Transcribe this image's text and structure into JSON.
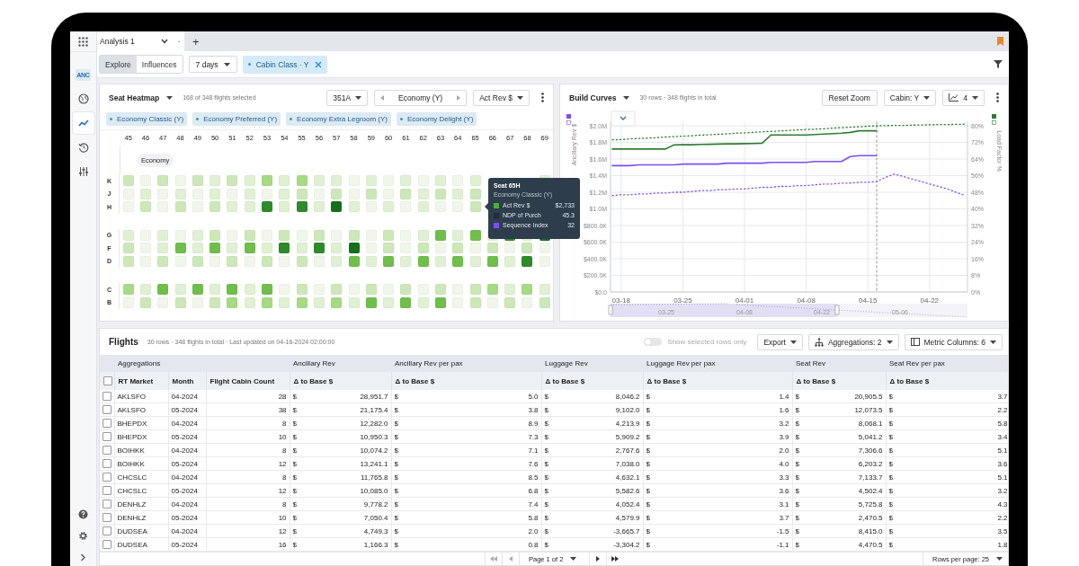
{
  "sidebar": {
    "items": [
      {
        "kind": "apps",
        "selected": false
      },
      {
        "kind": "logo",
        "label": "ANC",
        "selected": false
      },
      {
        "kind": "globe",
        "selected": false
      },
      {
        "kind": "trend",
        "selected": true
      },
      {
        "kind": "history",
        "selected": false
      },
      {
        "kind": "sliders",
        "selected": false
      }
    ],
    "bottom_items": [
      {
        "kind": "help"
      },
      {
        "kind": "settings"
      },
      {
        "kind": "expand"
      }
    ]
  },
  "tabs": [
    {
      "label": "Analysis 1",
      "selected": true
    }
  ],
  "tab_dot": "·",
  "new_tab": "+",
  "toolbar": {
    "view_modes": [
      {
        "label": "Explore",
        "selected": true
      },
      {
        "label": "Influences",
        "selected": false
      }
    ],
    "period": "7 days",
    "filters": [
      {
        "label": "Cabin Class · Y"
      }
    ]
  },
  "seat_heatmap": {
    "title": "Seat Heatmap",
    "subtitle": "168 of 348 flights selected",
    "aircraft": "351A",
    "cabin": "Economy (Y)",
    "metric": "Act Rev $",
    "fare_classes": [
      "Economy Classic (Y)",
      "Economy Preferred (Y)",
      "Economy Extra Legroom (Y)",
      "Economy Delight (Y)"
    ],
    "columns": [
      "45",
      "46",
      "47",
      "48",
      "49",
      "50",
      "51",
      "52",
      "53",
      "54",
      "55",
      "56",
      "57",
      "58",
      "59",
      "60",
      "61",
      "62",
      "63",
      "64",
      "65",
      "66",
      "67",
      "68",
      "69"
    ],
    "section_label": "Economy",
    "row_groups": [
      [
        "K",
        "J",
        "H"
      ],
      [
        "G",
        "F",
        "D"
      ],
      [
        "C",
        "B"
      ]
    ],
    "tooltip": {
      "title": "Seat 65H",
      "subtitle": "Economy Classic (Y)",
      "items": [
        {
          "label": "Act Rev $",
          "value": "$2,733",
          "color": "#4caf3a"
        },
        {
          "label": "NDP of Purch",
          "value": "45.3",
          "color": "#1e2d3a"
        },
        {
          "label": "Sequence Index",
          "value": "32",
          "color": "#7c4dff"
        }
      ]
    }
  },
  "build_curves": {
    "title": "Build Curves",
    "subtitle": "30 rows · 348 flights in total",
    "reset_button": "Reset Zoom",
    "cabin": "Cabin: Y",
    "series_count": "4",
    "navigator_labels": [
      "03-25",
      "04-08",
      "04-22",
      "05-06"
    ],
    "chart_data": {
      "type": "line",
      "ylabel": "Ancillary Rev $",
      "y2label": "Load Factor %",
      "grid": true,
      "categories": [
        null,
        "03-18",
        null,
        null,
        null,
        null,
        null,
        null,
        "03-25",
        null,
        null,
        null,
        null,
        null,
        null,
        "04-01",
        null,
        null,
        null,
        null,
        null,
        null,
        "04-08",
        null,
        null,
        null,
        null,
        null,
        null,
        "04-15",
        null,
        null,
        null,
        null,
        null,
        null,
        "04-22",
        null,
        null,
        null,
        null
      ],
      "series": [
        {
          "color": "#2e7d32",
          "axis": "y2",
          "line_style": "solid",
          "values": [
            68.8,
            68.8,
            68.8,
            68.8,
            68.8,
            68.8,
            68.8,
            70.8,
            70.9,
            70.9,
            71.0,
            71.1,
            71.2,
            71.3,
            71.3,
            71.4,
            71.5,
            71.6,
            75.6,
            75.6,
            75.6,
            75.6,
            75.6,
            75.8,
            76.0,
            76.2,
            76.4,
            76.8,
            77.6,
            77.6,
            77.6,
            null,
            null,
            null,
            null,
            null,
            null,
            null,
            null,
            null,
            null
          ]
        },
        {
          "color": "#2e7d32",
          "axis": "y2",
          "line_style": "dotted",
          "values": [
            73.2,
            73.4,
            73.7,
            73.9,
            74.1,
            74.3,
            74.6,
            74.8,
            75.0,
            75.2,
            75.5,
            75.7,
            75.9,
            76.1,
            76.4,
            76.6,
            76.8,
            77.1,
            77.3,
            77.5,
            77.7,
            78.0,
            78.2,
            78.4,
            78.6,
            78.9,
            79.1,
            79.3,
            79.5,
            79.8,
            80.0,
            80.1,
            80.2,
            80.2,
            80.3,
            80.4,
            80.5,
            80.6,
            80.6,
            80.7,
            80.8
          ]
        },
        {
          "color": "#7c4dff",
          "line_style": "solid",
          "values": [
            1520000,
            1520000,
            1520000,
            1530000,
            1530000,
            1530000,
            1530000,
            1530000,
            1540000,
            1540000,
            1540000,
            1540000,
            1540000,
            1550000,
            1550000,
            1550000,
            1550000,
            1550000,
            1560000,
            1560000,
            1560000,
            1560000,
            1560000,
            1570000,
            1570000,
            1570000,
            1570000,
            1630000,
            1640000,
            1640000,
            1640000,
            null,
            null,
            null,
            null,
            null,
            null,
            null,
            null,
            null,
            null
          ]
        },
        {
          "color": "#7c4dff",
          "line_style": "dotted",
          "values": [
            1160000,
            1170000,
            1170000,
            1180000,
            1180000,
            1190000,
            1190000,
            1200000,
            1200000,
            1210000,
            1220000,
            1220000,
            1230000,
            1230000,
            1240000,
            1240000,
            1250000,
            1260000,
            1260000,
            1270000,
            1270000,
            1280000,
            1280000,
            1290000,
            1300000,
            1300000,
            1310000,
            1310000,
            1320000,
            1320000,
            1330000,
            1380000,
            1420000,
            1390000,
            1360000,
            1330000,
            1300000,
            1270000,
            1240000,
            1200000,
            1160000
          ]
        }
      ],
      "ylim": [
        0,
        2050000
      ],
      "y2lim": [
        0,
        82
      ],
      "y2ticks": [
        {
          "value": 80,
          "label": "80%"
        },
        {
          "value": 72,
          "label": "72%"
        },
        {
          "value": 64,
          "label": "64%"
        },
        {
          "value": 56,
          "label": "56%"
        },
        {
          "value": 48,
          "label": "48%"
        },
        {
          "value": 40,
          "label": "40%"
        },
        {
          "value": 32,
          "label": "32%"
        },
        {
          "value": 24,
          "label": "24%"
        },
        {
          "value": 16,
          "label": "16%"
        },
        {
          "value": 8,
          "label": "8%"
        },
        {
          "value": 0,
          "label": "0%"
        }
      ],
      "yticks": [
        {
          "value": 0,
          "label": "$0.0"
        },
        {
          "value": 200000,
          "label": "$200.0K"
        },
        {
          "value": 400000,
          "label": "$400.0K"
        },
        {
          "value": 600000,
          "label": "$600.0K"
        },
        {
          "value": 800000,
          "label": "$800.0K"
        },
        {
          "value": 1000000,
          "label": "$1.0M"
        },
        {
          "value": 1200000,
          "label": "$1.2M"
        },
        {
          "value": 1400000,
          "label": "$1.4M"
        },
        {
          "value": 1600000,
          "label": "$1.6M"
        },
        {
          "value": 1800000,
          "label": "$1.8M"
        },
        {
          "value": 2000000,
          "label": "$2.0M"
        }
      ]
    }
  },
  "flights": {
    "title": "Flights",
    "subtitle": "30 rows · 348 flights in total · Last updated on 04-16-2024 02:00:00",
    "show_selected_only": {
      "label": "Show selected rows only",
      "on": false
    },
    "export_button": "Export",
    "aggregations_button": "Aggregations: 2",
    "metric_columns_button": "Metric Columns: 6",
    "group_headers": [
      "Aggregations",
      "Ancillary Rev",
      "Ancillary Rev per pax",
      "Luggage Rev",
      "Luggage Rev per pax",
      "Seat Rev",
      "Seat Rev per pax"
    ],
    "columns": [
      "RT Market",
      "Month",
      "Flight Cabin Count",
      "Δ to Base $",
      "Δ to Base $",
      "Δ to Base $",
      "Δ to Base $",
      "Δ to Base $",
      "Δ to Base $"
    ],
    "all_checked": false,
    "rows": [
      {
        "checked": false,
        "cells": [
          "AKLSFO",
          "04-2024",
          "28"
        ],
        "metrics": [
          [
            "$",
            "28,951.7"
          ],
          [
            "$",
            "5.0"
          ],
          [
            "$",
            "8,046.2"
          ],
          [
            "$",
            "1.4"
          ],
          [
            "$",
            "20,905.5"
          ],
          [
            "$",
            "3.7"
          ]
        ]
      },
      {
        "checked": false,
        "cells": [
          "AKLSFO",
          "05-2024",
          "38"
        ],
        "metrics": [
          [
            "$",
            "21,175.4"
          ],
          [
            "$",
            "3.8"
          ],
          [
            "$",
            "9,102.0"
          ],
          [
            "$",
            "1.6"
          ],
          [
            "$",
            "12,073.5"
          ],
          [
            "$",
            "2.2"
          ]
        ]
      },
      {
        "checked": false,
        "cells": [
          "BHEPDX",
          "04-2024",
          "8"
        ],
        "metrics": [
          [
            "$",
            "12,282.0"
          ],
          [
            "$",
            "8.9"
          ],
          [
            "$",
            "4,213.9"
          ],
          [
            "$",
            "3.2"
          ],
          [
            "$",
            "8,068.1"
          ],
          [
            "$",
            "5.8"
          ]
        ]
      },
      {
        "checked": false,
        "cells": [
          "BHEPDX",
          "05-2024",
          "10"
        ],
        "metrics": [
          [
            "$",
            "10,950.3"
          ],
          [
            "$",
            "7.3"
          ],
          [
            "$",
            "5,909.2"
          ],
          [
            "$",
            "3.9"
          ],
          [
            "$",
            "5,041.2"
          ],
          [
            "$",
            "3.4"
          ]
        ]
      },
      {
        "checked": false,
        "cells": [
          "BOIHKK",
          "04-2024",
          "8"
        ],
        "metrics": [
          [
            "$",
            "10,074.2"
          ],
          [
            "$",
            "7.1"
          ],
          [
            "$",
            "2,767.6"
          ],
          [
            "$",
            "2.0"
          ],
          [
            "$",
            "7,306.6"
          ],
          [
            "$",
            "5.1"
          ]
        ]
      },
      {
        "checked": false,
        "cells": [
          "BOIHKK",
          "05-2024",
          "12"
        ],
        "metrics": [
          [
            "$",
            "13,241.1"
          ],
          [
            "$",
            "7.6"
          ],
          [
            "$",
            "7,038.0"
          ],
          [
            "$",
            "4.0"
          ],
          [
            "$",
            "6,203.2"
          ],
          [
            "$",
            "3.6"
          ]
        ]
      },
      {
        "checked": false,
        "cells": [
          "CHCSLC",
          "04-2024",
          "8"
        ],
        "metrics": [
          [
            "$",
            "11,765.8"
          ],
          [
            "$",
            "8.5"
          ],
          [
            "$",
            "4,632.1"
          ],
          [
            "$",
            "3.3"
          ],
          [
            "$",
            "7,133.7"
          ],
          [
            "$",
            "5.1"
          ]
        ]
      },
      {
        "checked": false,
        "cells": [
          "CHCSLC",
          "05-2024",
          "12"
        ],
        "metrics": [
          [
            "$",
            "10,085.0"
          ],
          [
            "$",
            "6.8"
          ],
          [
            "$",
            "5,582.6"
          ],
          [
            "$",
            "3.6"
          ],
          [
            "$",
            "4,502.4"
          ],
          [
            "$",
            "3.2"
          ]
        ]
      },
      {
        "checked": false,
        "cells": [
          "DENHLZ",
          "04-2024",
          "8"
        ],
        "metrics": [
          [
            "$",
            "9,778.2"
          ],
          [
            "$",
            "7.4"
          ],
          [
            "$",
            "4,052.4"
          ],
          [
            "$",
            "3.1"
          ],
          [
            "$",
            "5,725.8"
          ],
          [
            "$",
            "4.3"
          ]
        ]
      },
      {
        "checked": false,
        "cells": [
          "DENHLZ",
          "05-2024",
          "10"
        ],
        "metrics": [
          [
            "$",
            "7,050.4"
          ],
          [
            "$",
            "5.8"
          ],
          [
            "$",
            "4,579.9"
          ],
          [
            "$",
            "3.7"
          ],
          [
            "$",
            "2,470.5"
          ],
          [
            "$",
            "2.2"
          ]
        ]
      },
      {
        "checked": false,
        "cells": [
          "DUDSEA",
          "04-2024",
          "12"
        ],
        "metrics": [
          [
            "$",
            "4,749.3"
          ],
          [
            "$",
            "2.0"
          ],
          [
            "$",
            "-3,665.7"
          ],
          [
            "$",
            "-1.5"
          ],
          [
            "$",
            "8,415.0"
          ],
          [
            "$",
            "3.5"
          ]
        ]
      },
      {
        "checked": false,
        "cells": [
          "DUDSEA",
          "05-2024",
          "16"
        ],
        "metrics": [
          [
            "$",
            "1,166.3"
          ],
          [
            "$",
            "0.8"
          ],
          [
            "$",
            "-3,304.2"
          ],
          [
            "$",
            "-1.1"
          ],
          [
            "$",
            "4,470.5"
          ],
          [
            "$",
            "1.8"
          ]
        ]
      }
    ],
    "pagination": {
      "page_label": "Page 1 of 2",
      "rows_per_page": "Rows per page: 25"
    }
  }
}
